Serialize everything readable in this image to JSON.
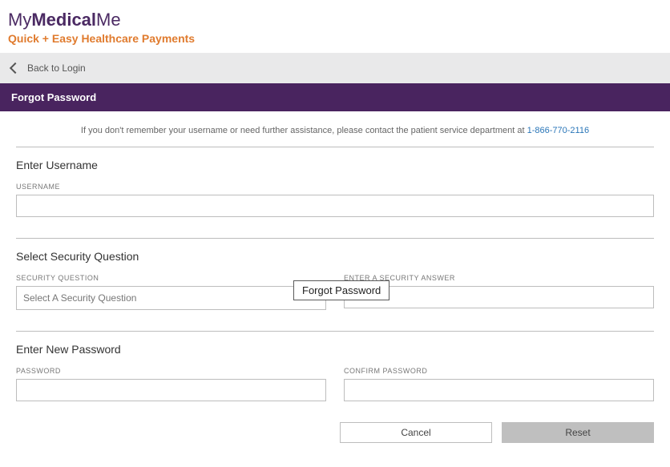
{
  "brand": {
    "part1": "My",
    "part2": "Medical",
    "part3": "Me",
    "tagline": "Quick + Easy Healthcare Payments"
  },
  "nav": {
    "back_label": "Back to Login"
  },
  "page": {
    "title": "Forgot Password",
    "assist_text": "If you don't remember your username or need further assistance, please contact the patient service department at ",
    "assist_phone": "1-866-770-2116"
  },
  "sections": {
    "username": {
      "title": "Enter Username",
      "field_label": "USERNAME",
      "value": ""
    },
    "security": {
      "title": "Select Security Question",
      "question_label": "SECURITY QUESTION",
      "question_placeholder": "Select A Security Question",
      "answer_label": "ENTER A SECURITY ANSWER",
      "tooltip": "Forgot Password"
    },
    "newpass": {
      "title": "Enter New Password",
      "password_label": "PASSWORD",
      "confirm_label": "CONFIRM PASSWORD"
    }
  },
  "buttons": {
    "cancel": "Cancel",
    "reset": "Reset"
  }
}
